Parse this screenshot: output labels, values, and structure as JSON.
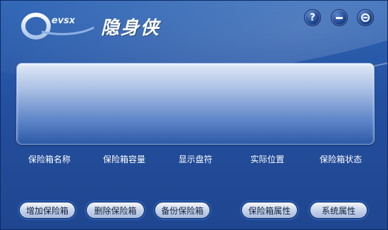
{
  "app": {
    "title": "隐身侠",
    "logo_text": "evsx"
  },
  "window_controls": {
    "help": "?"
  },
  "columns": [
    "保险箱名称",
    "保险箱容量",
    "显示盘符",
    "实际位置",
    "保险箱状态"
  ],
  "buttons": {
    "add": "增加保险箱",
    "delete": "删除保险箱",
    "backup": "备份保险箱",
    "properties": "保险箱属性",
    "system": "系统属性"
  },
  "colors": {
    "background": "#244f9f",
    "accent": "#2f66b6"
  }
}
